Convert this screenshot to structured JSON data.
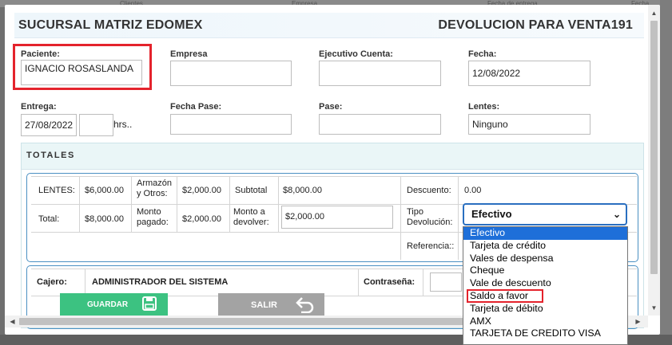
{
  "background": {
    "col1": "Clientes",
    "col2": "Empresa",
    "col3": "Fecha de entrega",
    "col4": "Fecha"
  },
  "header": {
    "branch": "SUCURSAL MATRIZ EDOMEX",
    "title": "DEVOLUCION PARA VENTA191"
  },
  "form": {
    "paciente": {
      "label": "Paciente:",
      "value": "IGNACIO ROSASLANDA"
    },
    "empresa": {
      "label": "Empresa",
      "value": ""
    },
    "ejecutivo": {
      "label": "Ejecutivo Cuenta:",
      "value": ""
    },
    "fecha": {
      "label": "Fecha:",
      "value": "12/08/2022"
    },
    "entrega": {
      "label": "Entrega:",
      "value": "27/08/2022",
      "hours": "",
      "hours_suffix": "hrs.."
    },
    "fecha_pase": {
      "label": "Fecha Pase:",
      "value": ""
    },
    "pase": {
      "label": "Pase:",
      "value": ""
    },
    "lentes": {
      "label": "Lentes:",
      "value": "Ninguno"
    }
  },
  "totales": {
    "title": "TOTALES",
    "lentes_label": "LENTES:",
    "lentes_value": "$6,000.00",
    "armazon_label": "Armazón y Otros:",
    "armazon_value": "$2,000.00",
    "subtotal_label": "Subtotal",
    "subtotal_value": "$8,000.00",
    "descuento_label": "Descuento:",
    "descuento_value": "0.00",
    "total_label": "Total:",
    "total_value": "$8,000.00",
    "monto_pagado_label": "Monto pagado:",
    "monto_pagado_value": "$2,000.00",
    "monto_devolver_label": "Monto a devolver:",
    "monto_devolver_value": "$2,000.00",
    "tipo_devolucion_label": "Tipo Devolución:",
    "tipo_devolucion_value": "Efectivo",
    "referencia_label": "Referencia::",
    "referencia_value": ""
  },
  "dropdown_options": [
    "Efectivo",
    "Tarjeta de crédito",
    "Vales de despensa",
    "Cheque",
    "Vale de descuento",
    "Saldo a favor",
    "Tarjeta de débito",
    "AMX",
    "TARJETA DE CREDITO VISA"
  ],
  "cajero": {
    "label": "Cajero:",
    "value": "ADMINISTRADOR DEL SISTEMA",
    "password_label": "Contraseña:",
    "password_value": ""
  },
  "buttons": {
    "guardar": "GUARDAR",
    "salir": "SALIR"
  },
  "icons": {
    "guardar": "floppy-disk-icon",
    "salir": "return-arrow-icon"
  },
  "colors": {
    "highlight_box": "#e4232c",
    "guardar_button": "#3cc281",
    "salir_button": "#a3a3a3",
    "selected_option": "#1e6fd9",
    "panel_border": "#4a90c2"
  }
}
